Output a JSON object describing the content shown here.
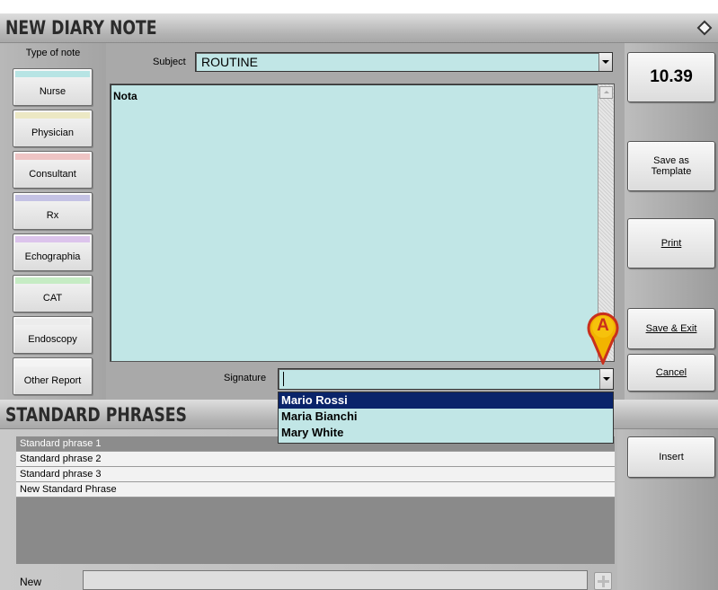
{
  "window": {
    "title": "NEW DIARY NOTE"
  },
  "note_types": {
    "header": "Type of note",
    "items": [
      {
        "label": "Nurse",
        "color": "#b7e4e4"
      },
      {
        "label": "Physician",
        "color": "#ece8c4"
      },
      {
        "label": "Consultant",
        "color": "#eec4c4"
      },
      {
        "label": "Rx",
        "color": "#c4c2e4"
      },
      {
        "label": "Echographia",
        "color": "#dcc4ec"
      },
      {
        "label": "CAT",
        "color": "#c6ecc4"
      },
      {
        "label": "Endoscopy",
        "color": "#ececec"
      },
      {
        "label": "Other Report",
        "color": "#f4f4f4"
      }
    ]
  },
  "subject": {
    "label": "Subject",
    "value": "ROUTINE"
  },
  "note": {
    "text": "Nota"
  },
  "signature": {
    "label": "Signature",
    "value": "",
    "options": [
      "Mario Rossi",
      "Maria Bianchi",
      "Mary White"
    ],
    "selected": "Mario Rossi"
  },
  "time": "10.39",
  "actions": {
    "save_template_line1": "Save as",
    "save_template_line2": "Template",
    "print": "Print",
    "save_exit": "Save & Exit",
    "cancel": "Cancel",
    "insert": "Insert"
  },
  "marker": {
    "label": "A",
    "color": "#e8a800"
  },
  "standard_phrases": {
    "title": "STANDARD PHRASES",
    "items": [
      "Standard phrase 1",
      "Standard phrase 2",
      "Standard phrase 3",
      "New Standard Phrase"
    ],
    "selected": "Standard phrase 1",
    "new_label": "New",
    "new_value": ""
  },
  "colors": {
    "field_bg": "#c1e6e6",
    "selection": "#0a246a"
  }
}
